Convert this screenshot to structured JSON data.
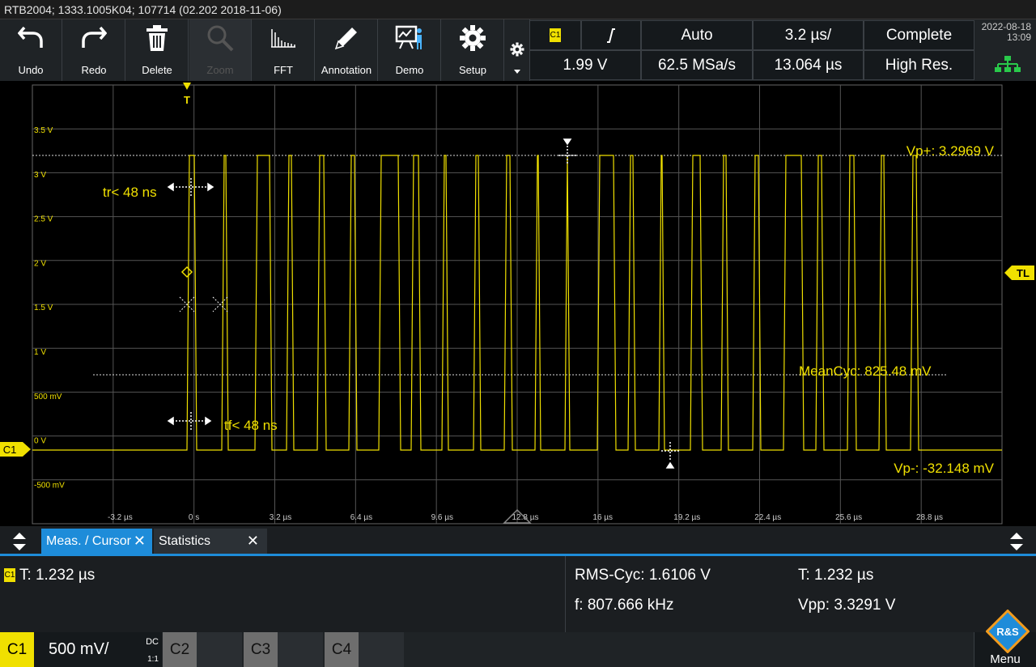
{
  "window": {
    "title": "RTB2004; 1333.1005K04; 107714 (02.202 2018-11-06)"
  },
  "toolbar": {
    "undo": "Undo",
    "redo": "Redo",
    "delete": "Delete",
    "zoom": "Zoom",
    "fft": "FFT",
    "annotation": "Annotation",
    "demo": "Demo",
    "setup": "Setup"
  },
  "trigger": {
    "source": "C1",
    "slope_icon": "rising-edge-icon",
    "mode": "Auto",
    "timebase": "3.2 µs/",
    "acq_state": "Complete",
    "level": "1.99 V",
    "sample_rate": "62.5 MSa/s",
    "position": "13.064 µs",
    "acq_mode": "High Res."
  },
  "datetime": {
    "date": "2022-08-18",
    "time": "13:09"
  },
  "waveform": {
    "channel_label": "C1",
    "trigger_marker": "T",
    "trigger_level_marker": "TL",
    "y_ticks": [
      "3.5 V",
      "3 V",
      "2.5 V",
      "2 V",
      "1.5 V",
      "1 V",
      "500 mV",
      "0 V",
      "-500 mV"
    ],
    "x_ticks": [
      "-3.2 µs",
      "0 s",
      "3.2 µs",
      "6.4 µs",
      "9.6 µs",
      "12.8 µs",
      "16 µs",
      "19.2 µs",
      "22.4 µs",
      "25.6 µs",
      "28.8 µs"
    ],
    "vp_plus": "Vp+: 3.2969 V",
    "vp_minus": "Vp-: -32.148 mV",
    "mean_cyc": "MeanCyc: 825.48 mV",
    "rise_time": "tr< 48 ns",
    "fall_time": "tf< 48 ns",
    "color": "#f0e000"
  },
  "tabs": {
    "meas_cursor": "Meas. / Cursor",
    "statistics": "Statistics"
  },
  "measurements": {
    "channel": "C1",
    "period_left": "T: 1.232 µs",
    "rms_cyc": "RMS-Cyc: 1.6106 V",
    "frequency": "f: 807.666 kHz",
    "period_right": "T: 1.232 µs",
    "vpp": "Vpp: 3.3291 V"
  },
  "channels": {
    "c1": "C1",
    "c1_scale": "500 mV/",
    "c1_coupling": "DC",
    "c1_ratio": "1:1",
    "c2": "C2",
    "c3": "C3",
    "c4": "C4"
  },
  "menu": {
    "label": "Menu",
    "logo": "R&S"
  }
}
